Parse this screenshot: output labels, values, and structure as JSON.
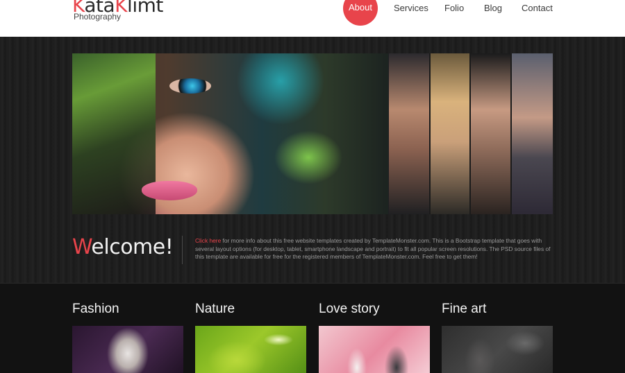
{
  "header": {
    "logo": {
      "part1": "K",
      "part2": "ata",
      "part3": "K",
      "part4": "limt",
      "subtitle": "Photography"
    },
    "nav": [
      {
        "label": "About",
        "active": true
      },
      {
        "label": "Services"
      },
      {
        "label": "Folio"
      },
      {
        "label": "Blog"
      },
      {
        "label": "Contact"
      }
    ]
  },
  "welcome": {
    "title_first": "W",
    "title_rest": "elcome!",
    "link": "Click here",
    "text": " for more info about this free website templates created by TemplateMonster.com. This is a Bootstrap template that goes with several layout options (for desktop, tablet, smartphone landscape and portrait) to fit all popular screen resolutions. The PSD source files of this template are available for free for the registered members of TemplateMonster.com. Feel free to get them!"
  },
  "categories": [
    {
      "title": "Fashion"
    },
    {
      "title": "Nature"
    },
    {
      "title": "Love story"
    },
    {
      "title": "Fine art"
    }
  ],
  "colors": {
    "accent": "#e8444b",
    "background": "#1b1b1b",
    "header_bg": "#ffffff"
  }
}
